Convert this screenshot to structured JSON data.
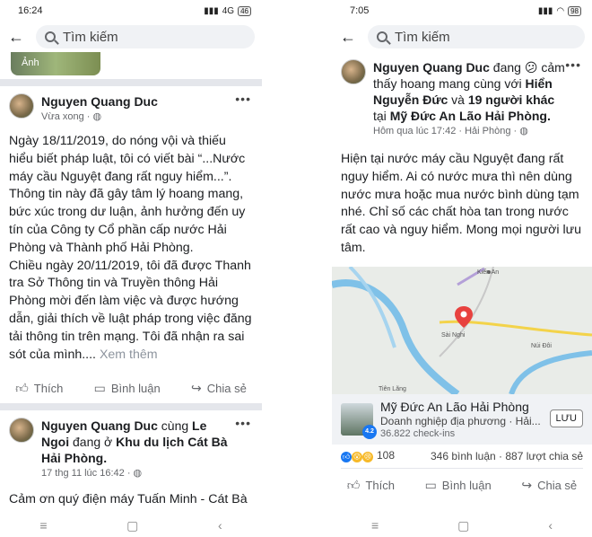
{
  "left": {
    "status": {
      "time": "16:24",
      "network": "4G",
      "battery": "46"
    },
    "search_placeholder": "Tìm kiếm",
    "thumb_label": "Ảnh",
    "post1": {
      "author": "Nguyen Quang Duc",
      "meta": "Vừa xong · ",
      "text": "Ngày 18/11/2019, do nóng vội và thiếu hiểu biết pháp luật, tôi có viết bài “...Nước máy cầu Nguyệt đang rất nguy hiểm...”. Thông tin này đã gây tâm lý hoang mang, bức xúc trong dư luận, ảnh hưởng đến uy tín của Công ty Cổ phần cấp nước Hải Phòng và Thành phố Hải Phòng.",
      "text2": "Chiều ngày 20/11/2019, tôi đã được Thanh tra Sở Thông tin và Truyền thông Hải Phòng mời đến làm việc và được hướng dẫn, giải thích về luật pháp trong việc đăng tải thông tin trên mạng. Tôi đã nhận ra sai sót của mình....",
      "see_more": " Xem thêm"
    },
    "actions": {
      "like": "Thích",
      "comment": "Bình luận",
      "share": "Chia sẻ"
    },
    "post2": {
      "author": "Nguyen Quang Duc",
      "with_word": " cùng ",
      "tagged": "Le Ngoi",
      "at_word": " đang ở ",
      "place": "Khu du lịch Cát Bà Hải Phòng.",
      "meta": "17 thg 11 lúc 16:42 · ",
      "text": "Cảm ơn quý điện máy Tuấn Minh - Cát Bà"
    }
  },
  "right": {
    "status": {
      "time": "7:05",
      "battery": "98"
    },
    "search_placeholder": "Tìm kiếm",
    "post": {
      "author": "Nguyen Quang Duc",
      "feeling": " đang ",
      "feeling2": " cảm thấy hoang mang cùng với ",
      "with1": "Hiển Nguyễn Đức",
      "and_word": " và ",
      "with2": "19 người khác",
      "at_word": " tại ",
      "place": "Mỹ Đức An Lão Hải Phòng.",
      "meta": "Hôm qua lúc 17:42 · Hải Phòng · ",
      "text": "Hiện tại nước máy cầu Nguyệt đang rất nguy hiểm. Ai có nước mưa thì nên dùng nước mưa hoặc mua nước bình dùng tạm nhé. Chỉ số các chất hòa tan trong nước rất cao và nguy hiểm. Mong mọi người lưu tâm."
    },
    "map_labels": {
      "kien_an": "Kiến An",
      "sai_nghi": "Sài Nghi",
      "nui_doi": "Núi Đôi",
      "tien_lang": "Tiên Lãng"
    },
    "place_card": {
      "name": "Mỹ Đức An Lão Hải Phòng",
      "category": "Doanh nghiệp địa phương · Hải...",
      "checkins": "36.822 check-ins",
      "rating": "4.2",
      "save": "LƯU"
    },
    "reactions": {
      "count": "108",
      "comments": "346 bình luận",
      "shares": "887 lượt chia sẻ",
      "sep": " · "
    },
    "actions": {
      "like": "Thích",
      "comment": "Bình luận",
      "share": "Chia sẻ"
    }
  },
  "icons": {
    "back": "arrow-left-icon",
    "search": "search-icon",
    "more": "more-dots-icon",
    "globe": "globe-icon"
  },
  "colors": {
    "link": "#1877f2",
    "meta": "#65676b",
    "separator": "#e4e6eb"
  }
}
